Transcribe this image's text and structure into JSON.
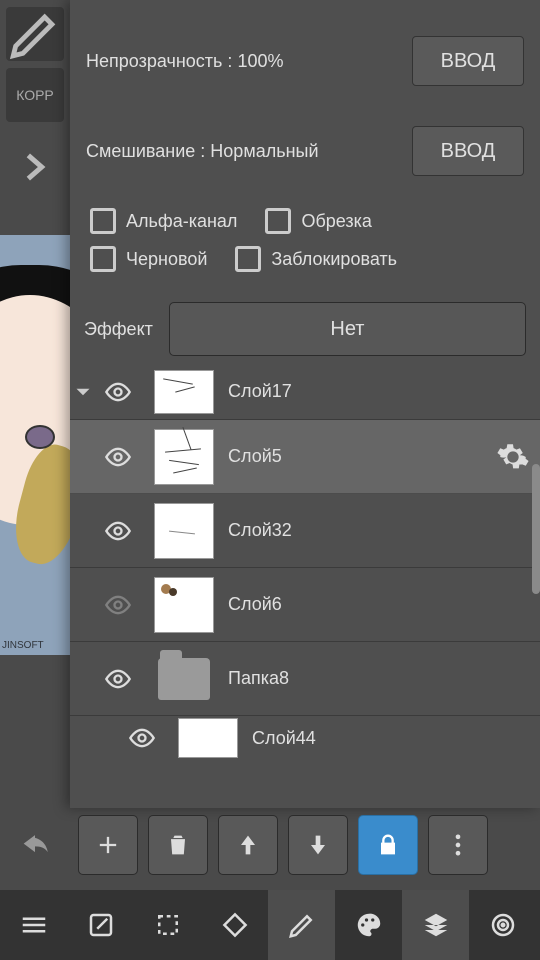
{
  "toolbar_left_edit_hint": "КОРР",
  "opacity": {
    "label": "Непрозрачность",
    "value": "100%",
    "enter": "ВВОД"
  },
  "blend": {
    "label": "Смешивание",
    "value": "Нормальный",
    "enter": "ВВОД"
  },
  "checks": {
    "alpha": "Альфа-канал",
    "clip": "Обрезка",
    "draft": "Черновой",
    "lock": "Заблокировать"
  },
  "effect": {
    "label": "Эффект",
    "value": "Нет"
  },
  "layers": [
    {
      "name": "Слой17",
      "visible": true,
      "indent": 1,
      "type": "layer",
      "partial": "top"
    },
    {
      "name": "Слой5",
      "visible": true,
      "indent": 0,
      "type": "layer",
      "selected": true
    },
    {
      "name": "Слой32",
      "visible": true,
      "indent": 0,
      "type": "layer"
    },
    {
      "name": "Слой6",
      "visible": false,
      "indent": 0,
      "type": "layer"
    },
    {
      "name": "Папка8",
      "visible": true,
      "indent": 0,
      "type": "folder"
    },
    {
      "name": "Слой44",
      "visible": true,
      "indent": 1,
      "type": "layer",
      "partial": "bottom"
    }
  ],
  "canvas_signature": "JINSOFT",
  "strip_buttons": [
    "add",
    "delete",
    "move-up",
    "move-down",
    "lock",
    "more"
  ],
  "lock_active": true,
  "bottom_tool_active": "layers",
  "colors": {
    "accent": "#3a8ccc",
    "panel": "#4f4f4f",
    "bar": "#333333"
  }
}
